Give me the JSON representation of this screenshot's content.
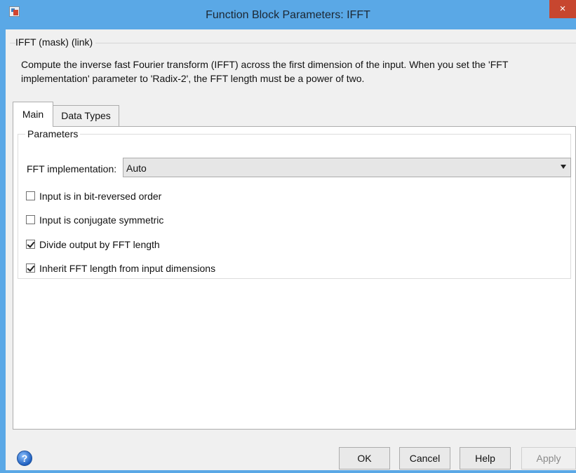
{
  "window": {
    "title": "Function Block Parameters: IFFT",
    "close_glyph": "×",
    "app_icon": "simulink-block-icon"
  },
  "mask": {
    "legend": "IFFT (mask) (link)",
    "description": "Compute the inverse fast Fourier transform (IFFT) across the first dimension of the input. When you set the 'FFT implementation' parameter to 'Radix-2', the FFT length must be a power of two."
  },
  "tabs": [
    {
      "label": "Main",
      "selected": true
    },
    {
      "label": "Data Types",
      "selected": false
    }
  ],
  "parameters": {
    "legend": "Parameters",
    "fft_implementation": {
      "label": "FFT implementation:",
      "value": "Auto"
    },
    "checkboxes": [
      {
        "label": "Input is in bit-reversed order",
        "checked": false
      },
      {
        "label": "Input is conjugate symmetric",
        "checked": false
      },
      {
        "label": "Divide output by FFT length",
        "checked": true
      },
      {
        "label": "Inherit FFT length from input dimensions",
        "checked": true
      }
    ]
  },
  "buttons": {
    "help_icon_glyph": "?",
    "ok": "OK",
    "cancel": "Cancel",
    "help": "Help",
    "apply": "Apply"
  },
  "colors": {
    "titlebar": "#5aa8e6",
    "close": "#c7462f",
    "dialog_bg": "#f0f0f0"
  }
}
